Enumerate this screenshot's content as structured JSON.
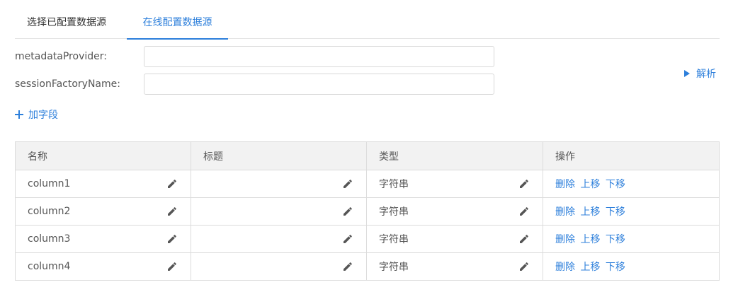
{
  "tabs": [
    {
      "label": "选择已配置数据源",
      "active": false
    },
    {
      "label": "在线配置数据源",
      "active": true
    }
  ],
  "form": {
    "metadata_label": "metadataProvider:",
    "metadata_value": "",
    "session_label": "sessionFactoryName:",
    "session_value": ""
  },
  "parse_label": "解析",
  "add_field_label": "加字段",
  "table": {
    "headers": [
      "名称",
      "标题",
      "类型",
      "操作"
    ],
    "rows": [
      {
        "name": "column1",
        "title": "",
        "type": "字符串"
      },
      {
        "name": "column2",
        "title": "",
        "type": "字符串"
      },
      {
        "name": "column3",
        "title": "",
        "type": "字符串"
      },
      {
        "name": "column4",
        "title": "",
        "type": "字符串"
      }
    ],
    "actions": {
      "delete": "删除",
      "move_up": "上移",
      "move_down": "下移"
    }
  },
  "colors": {
    "accent": "#2d7fdb",
    "header_bg": "#f2f2f2",
    "border": "#dcdcdc"
  }
}
